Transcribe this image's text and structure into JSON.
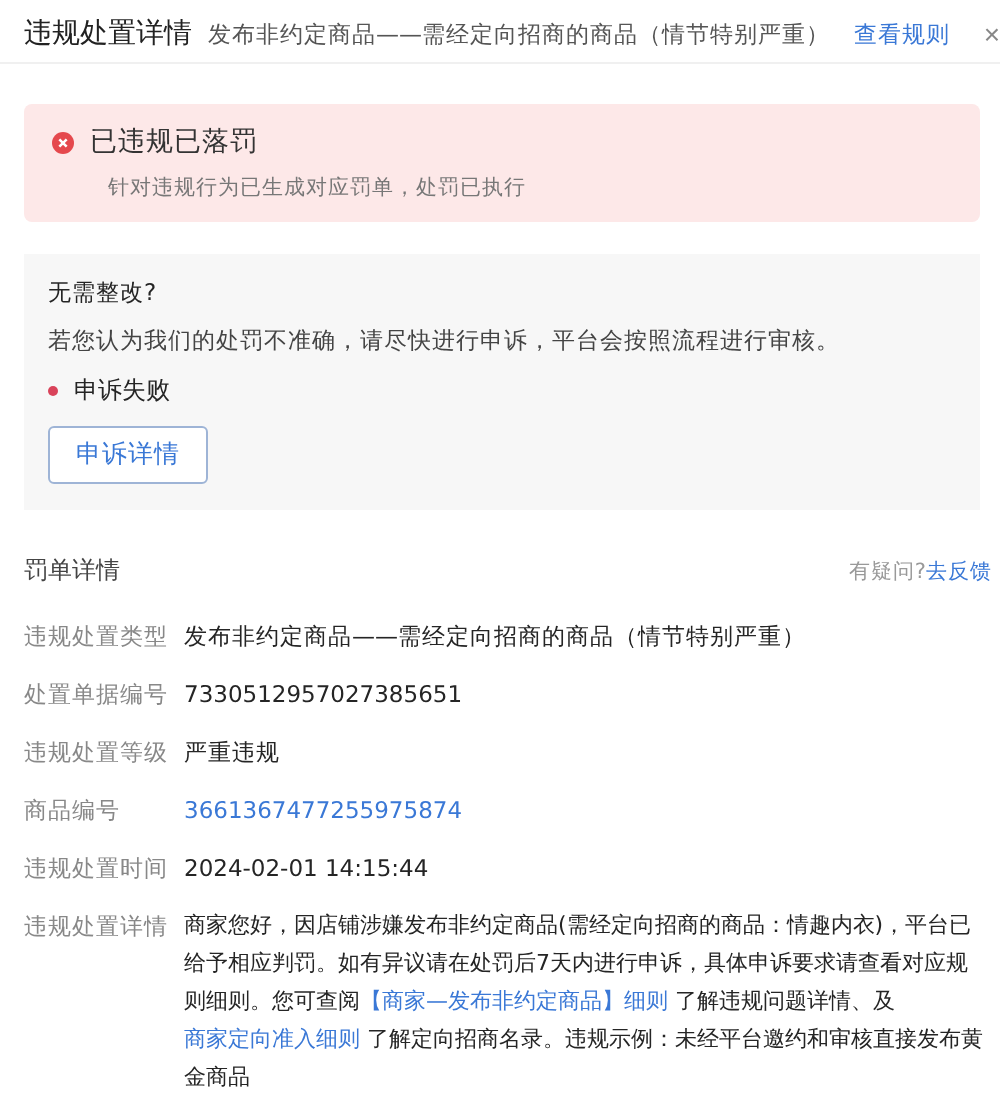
{
  "header": {
    "title": "违规处置详情",
    "subtitle": "发布非约定商品——需经定向招商的商品（情节特别严重）",
    "rule_link": "查看规则",
    "close": "×"
  },
  "alert": {
    "title": "已违规已落罚",
    "description": "针对违规行为已生成对应罚单，处罚已执行"
  },
  "appeal": {
    "title": "无需整改?",
    "text": "若您认为我们的处罚不准确，请尽快进行申诉，平台会按照流程进行审核。",
    "status": "申诉失败",
    "button": "申诉详情"
  },
  "details": {
    "title": "罚单详情",
    "question": "有疑问?",
    "feedback_link": "去反馈",
    "rows": [
      {
        "label": "违规处置类型",
        "kind": "text",
        "value": "发布非约定商品——需经定向招商的商品（情节特别严重）"
      },
      {
        "label": "处置单据编号",
        "kind": "text",
        "value": "7330512957027385651"
      },
      {
        "label": "违规处置等级",
        "kind": "text",
        "value": "严重违规"
      },
      {
        "label": "商品编号",
        "kind": "link",
        "value": "3661367477255975874"
      },
      {
        "label": "违规处置时间",
        "kind": "text",
        "value": "2024-02-01 14:15:44"
      },
      {
        "label": "违规处置详情",
        "kind": "rich",
        "segments": [
          {
            "kind": "text",
            "text": "商家您好，因店铺涉嫌发布非约定商品(需经定向招商的商品：情趣内衣)，平台已给予相应判罚。如有异议请在处罚后7天内进行申诉，具体申诉要求请查看对应规则细则。您可查阅"
          },
          {
            "kind": "link",
            "text": "【商家—发布非约定商品】细则"
          },
          {
            "kind": "text",
            "text": " 了解违规问题详情、及"
          },
          {
            "kind": "link",
            "text": "商家定向准入细则"
          },
          {
            "kind": "text",
            "text": " 了解定向招商名录。违规示例：未经平台邀约和审核直接发布黄金商品"
          }
        ]
      }
    ]
  }
}
